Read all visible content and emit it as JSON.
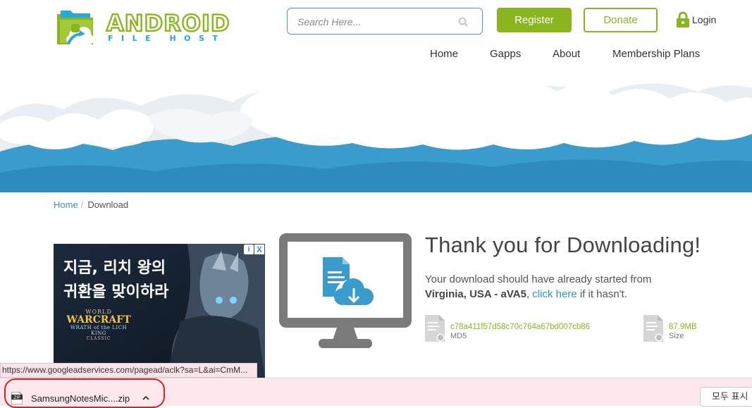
{
  "logo": {
    "title": "ANDROID",
    "subtitle": "FILE HOST"
  },
  "search": {
    "placeholder": "Search Here..."
  },
  "header": {
    "register_label": "Register",
    "donate_label": "Donate",
    "login_label": "Login"
  },
  "nav": {
    "items": [
      {
        "label": "Home"
      },
      {
        "label": "Gapps"
      },
      {
        "label": "About"
      },
      {
        "label": "Membership Plans"
      }
    ]
  },
  "breadcrumb": {
    "home": "Home",
    "separator": "/",
    "current": "Download"
  },
  "ad": {
    "line1": "지금, 리치 왕의",
    "line2": "귀환을 맞이하라",
    "brand_world": "WORLD",
    "brand_warcraft": "WARCRAFT",
    "brand_expansion": "WRATH of the LICH KING",
    "brand_classic": "CLASSIC",
    "info_icon": "i",
    "close_icon": "X"
  },
  "download": {
    "title": "Thank you for Downloading!",
    "message_prefix": "Your download should have already started from",
    "location": "Virginia, USA - aVA5",
    "comma": ",",
    "link_text": "click here",
    "message_suffix": "if it hasn't.",
    "md5_value": "c78a411f57d58c70c764a67bd007cb86",
    "md5_label": "MD5",
    "size_value": "87.9MB",
    "size_label": "Size"
  },
  "status_bar": {
    "url": "https://www.googleadservices.com/pagead/aclk?sa=L&ai=CmM..."
  },
  "shelf": {
    "filename": "SamsungNotesMic....zip",
    "show_all_label": "모두 표시"
  },
  "colors": {
    "brand_green": "#8ab51f",
    "brand_blue": "#2a97c9",
    "banner_blue": "#3a9ccc"
  }
}
